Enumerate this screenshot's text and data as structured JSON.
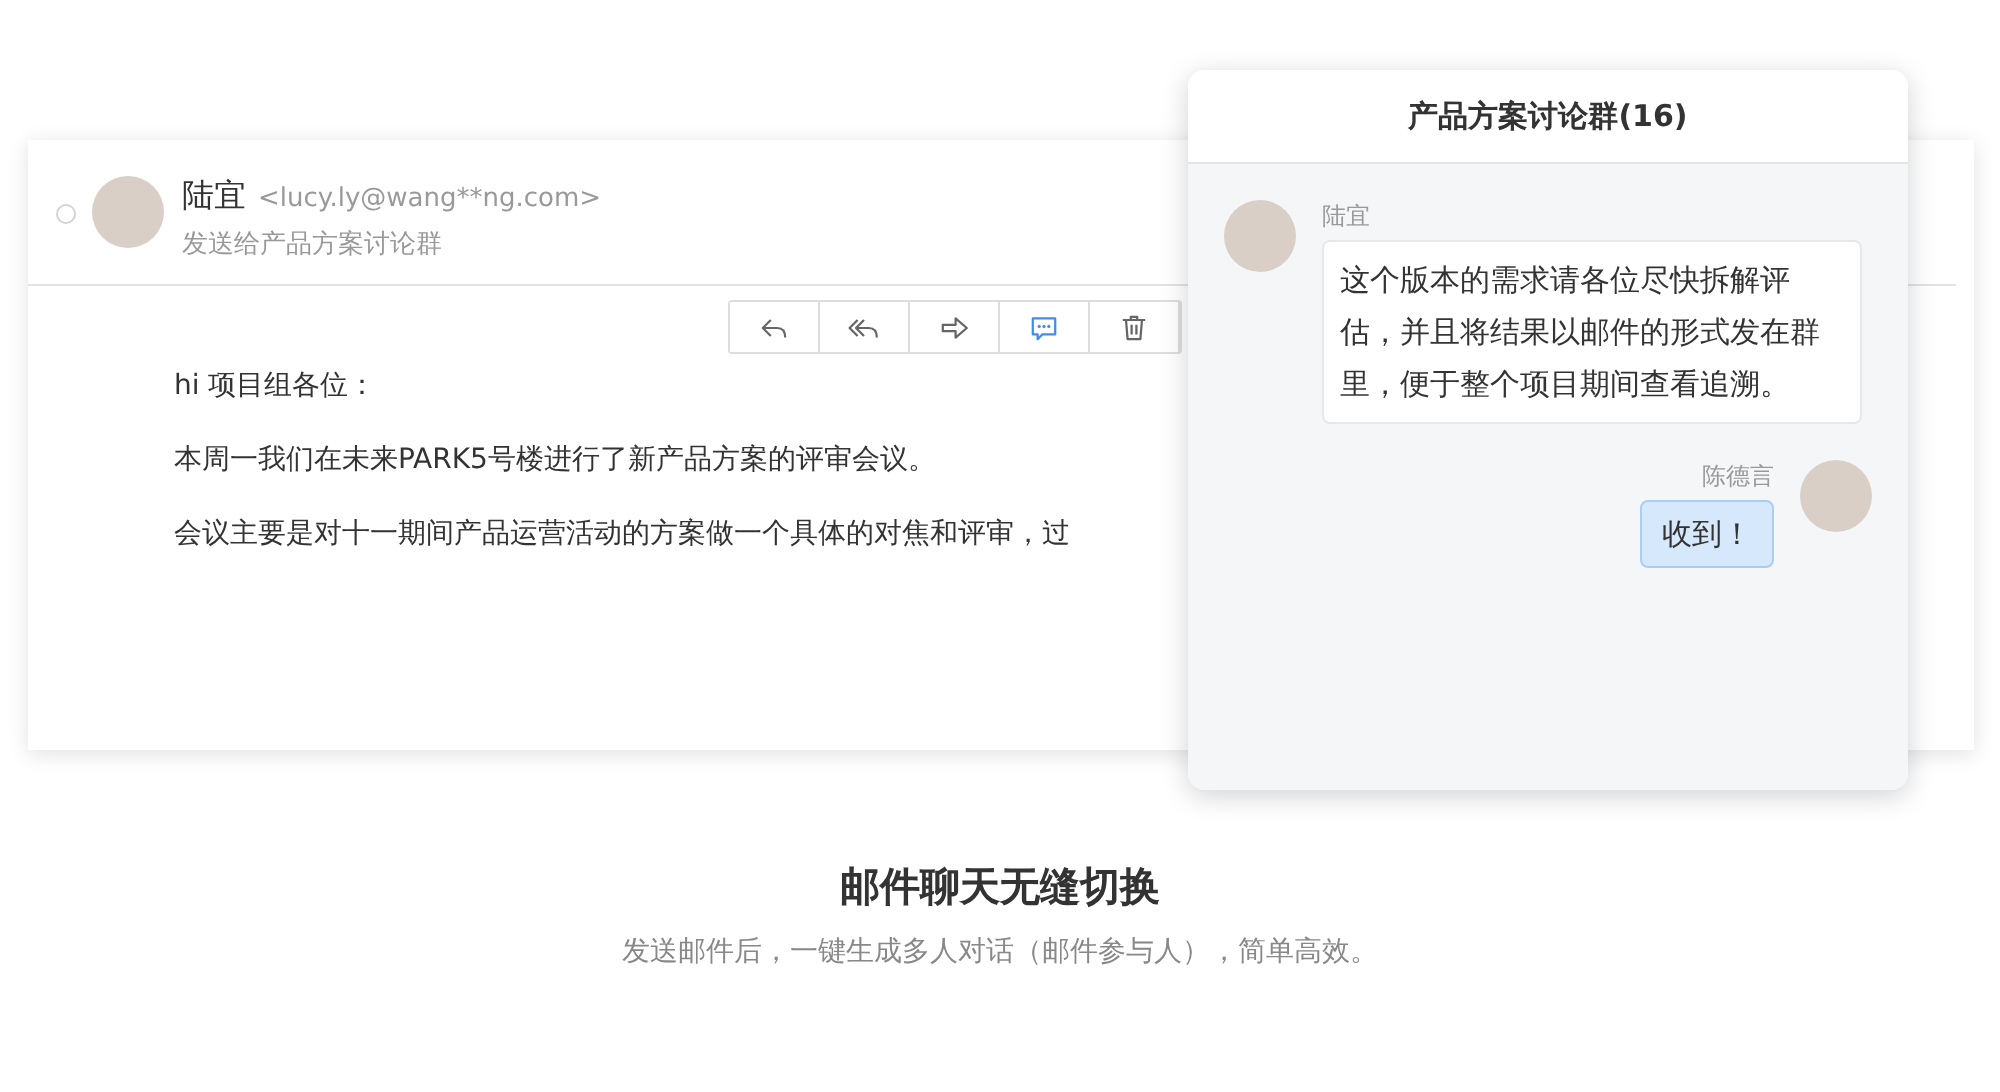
{
  "email": {
    "sender_name": "陆宜",
    "sender_email": "<lucy.ly@wang**ng.com>",
    "recipient_line": "发送给产品方案讨论群",
    "toolbar": [
      {
        "kind": "reply",
        "active": false
      },
      {
        "kind": "reply-all",
        "active": false
      },
      {
        "kind": "forward",
        "active": false
      },
      {
        "kind": "chat",
        "active": true
      },
      {
        "kind": "delete",
        "active": false
      }
    ],
    "body": [
      "hi 项目组各位：",
      "本周一我们在未来PARK5号楼进行了新产品方案的评审会议。",
      "会议主要是对十一期间产品运营活动的方案做一个具体的对焦和评审，过"
    ]
  },
  "chat": {
    "title": "产品方案讨论群(16)",
    "messages": [
      {
        "kind": "incoming",
        "sender": "陆宜",
        "text": "这个版本的需求请各位尽快拆解评估，并且将结果以邮件的形式发在群里，便于整个项目期间查看追溯。"
      },
      {
        "kind": "outgoing",
        "sender": "陈德言",
        "text": "收到！"
      }
    ]
  },
  "feature": {
    "title": "邮件聊天无缝切换",
    "subtitle": "发送邮件后，一键生成多人对话（邮件参与人），简单高效。"
  }
}
